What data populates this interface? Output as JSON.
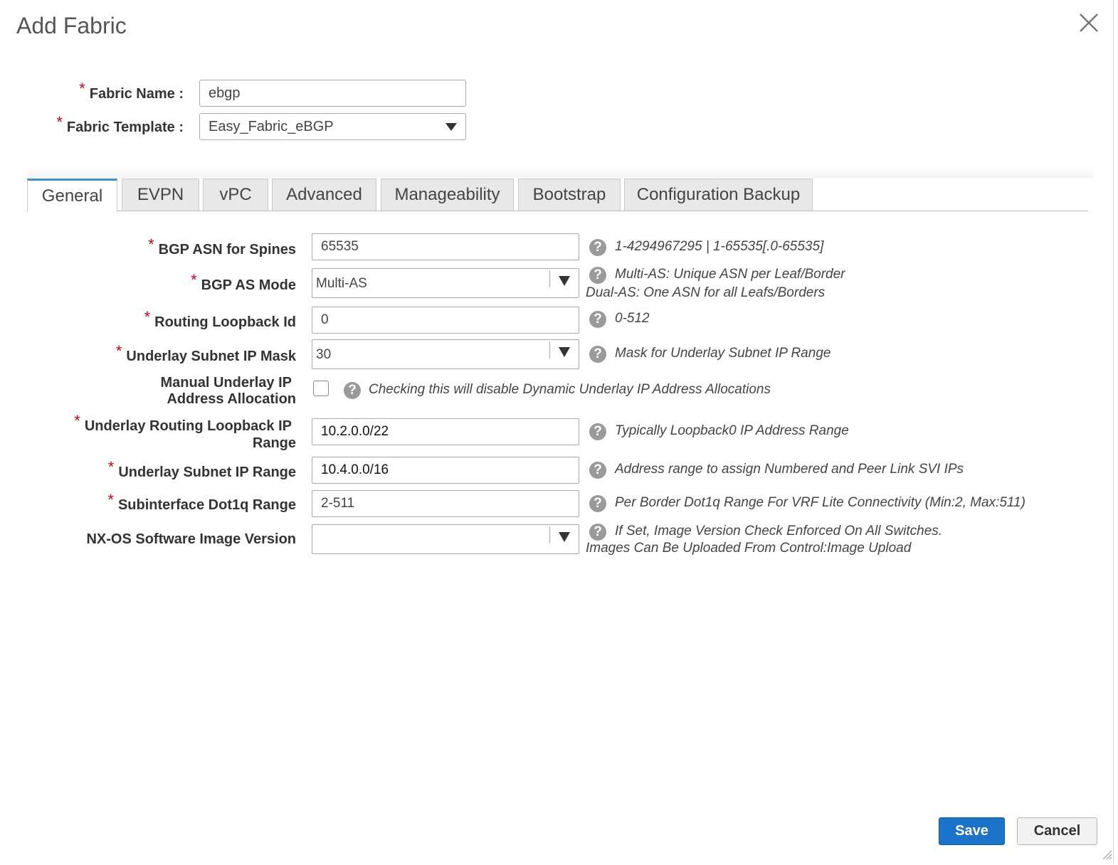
{
  "dialog": {
    "title": "Add Fabric"
  },
  "header": {
    "fabric_name": {
      "label": "Fabric Name :",
      "value": "ebgp"
    },
    "fabric_template": {
      "label": "Fabric Template :",
      "value": "Easy_Fabric_eBGP"
    }
  },
  "required_mark": "*",
  "tabs": [
    {
      "label": "General",
      "active": true
    },
    {
      "label": "EVPN"
    },
    {
      "label": "vPC"
    },
    {
      "label": "Advanced"
    },
    {
      "label": "Manageability"
    },
    {
      "label": "Bootstrap"
    },
    {
      "label": "Configuration Backup"
    }
  ],
  "help_glyph": "?",
  "fields": {
    "bgp_asn": {
      "label": "BGP ASN for Spines",
      "value": "65535",
      "help": "1-4294967295 | 1-65535[.0-65535]"
    },
    "bgp_as_mode": {
      "label": "BGP AS Mode",
      "value": "Multi-AS",
      "help_line1": "Multi-AS: Unique ASN per Leaf/Border",
      "help_line2": "Dual-AS: One ASN for all Leafs/Borders"
    },
    "routing_loopback_id": {
      "label": "Routing Loopback Id",
      "value": "0",
      "help": "0-512"
    },
    "underlay_subnet_mask": {
      "label": "Underlay Subnet IP Mask",
      "value": "30",
      "help": "Mask for Underlay Subnet IP Range"
    },
    "manual_underlay": {
      "label_line1": "Manual Underlay IP",
      "label_line2": "Address Allocation",
      "checked": false,
      "help": "Checking this will disable Dynamic Underlay IP Address Allocations"
    },
    "underlay_routing_loopback": {
      "label_line1": "Underlay Routing Loopback IP",
      "label_line2": "Range",
      "value": "10.2.0.0/22",
      "help": "Typically Loopback0 IP Address Range"
    },
    "underlay_subnet_range": {
      "label": "Underlay Subnet IP Range",
      "value": "10.4.0.0/16",
      "help": "Address range to assign Numbered and Peer Link SVI IPs"
    },
    "subinterface_dot1q": {
      "label": "Subinterface Dot1q Range",
      "value": "2-511",
      "help": "Per Border Dot1q Range For VRF Lite Connectivity (Min:2, Max:511)"
    },
    "nxos_image": {
      "label": "NX-OS Software Image Version",
      "value": "",
      "help_line1": "If Set, Image Version Check Enforced On All Switches.",
      "help_line2": "Images Can Be Uploaded From Control:Image Upload"
    }
  },
  "footer": {
    "save_label": "Save",
    "cancel_label": "Cancel"
  },
  "colors": {
    "accent": "#1a73c8",
    "required": "#d0021b",
    "active_tab_border": "#3e8fd6"
  }
}
